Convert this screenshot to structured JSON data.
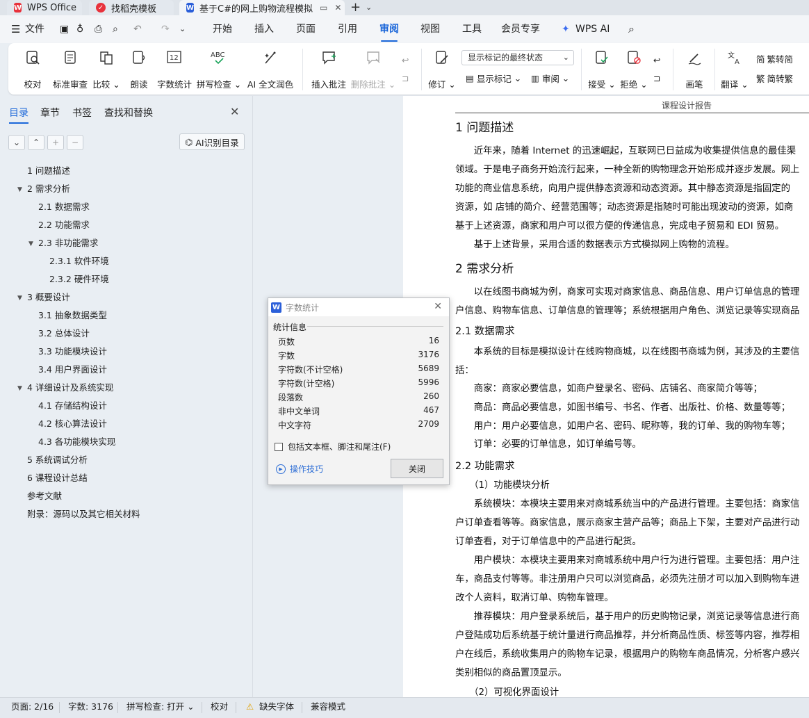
{
  "tabs": [
    {
      "label": "WPS Office"
    },
    {
      "label": "找稻壳模板"
    },
    {
      "label": "基于C#的网上购物流程模拟"
    }
  ],
  "menu": {
    "file": "文件",
    "items": [
      "开始",
      "插入",
      "页面",
      "引用",
      "审阅",
      "视图",
      "工具",
      "会员专享"
    ],
    "active": "审阅",
    "ai": "WPS AI"
  },
  "ribbon": {
    "proofread": "校对",
    "standard_review": "标准审查",
    "compare": "比较",
    "read_aloud": "朗读",
    "word_count": "字数统计",
    "spell_check": "拼写检查",
    "ai_polish": "AI 全文润色",
    "insert_comment": "插入批注",
    "delete_comment": "删除批注",
    "revise": "修订",
    "display_mode": "显示标记的最终状态",
    "show_marks": "显示标记",
    "review": "审阅",
    "accept": "接受",
    "reject": "拒绝",
    "pen": "画笔",
    "translate": "翻译",
    "to_traditional": "繁转简",
    "to_simplified": "简转繁"
  },
  "nav": {
    "tabs": [
      "目录",
      "章节",
      "书签",
      "查找和替换"
    ],
    "ai_toc": "AI识别目录",
    "toc": [
      {
        "label": "1 问题描述"
      },
      {
        "label": "2 需求分析"
      },
      {
        "label": "2.1 数据需求"
      },
      {
        "label": "2.2 功能需求"
      },
      {
        "label": "2.3 非功能需求"
      },
      {
        "label": "2.3.1 软件环境"
      },
      {
        "label": "2.3.2 硬件环境"
      },
      {
        "label": "3 概要设计"
      },
      {
        "label": "3.1 抽象数据类型"
      },
      {
        "label": "3.2 总体设计"
      },
      {
        "label": "3.3 功能模块设计"
      },
      {
        "label": "3.4 用户界面设计"
      },
      {
        "label": "4 详细设计及系统实现"
      },
      {
        "label": "4.1 存储结构设计"
      },
      {
        "label": "4.2 核心算法设计"
      },
      {
        "label": "4.3 各功能模块实现"
      },
      {
        "label": "5 系统调试分析"
      },
      {
        "label": "6 课程设计总结"
      },
      {
        "label": "参考文献"
      },
      {
        "label": "附录：源码以及其它相关材料"
      }
    ]
  },
  "document": {
    "header": "课程设计报告",
    "lines": [
      {
        "text": "1 问题描述",
        "style": "h1"
      },
      {
        "text": "　　近年来，随着 Internet 的迅速崛起，互联网已日益成为收集提供信息的最佳渠",
        "style": "p"
      },
      {
        "text": "领域。于是电子商务开始流行起来，一种全新的购物理念开始形成并逐步发展。网上",
        "style": "p"
      },
      {
        "text": "功能的商业信息系统，向用户提供静态资源和动态资源。其中静态资源是指固定的",
        "style": "p"
      },
      {
        "text": "资源，如 店铺的简介、经营范围等；动态资源是指随时可能出现波动的资源，如商",
        "style": "p"
      },
      {
        "text": "基于上述资源，商家和用户可以很方便的传递信息，完成电子贸易和 EDI 贸易。",
        "style": "p"
      },
      {
        "text": "　　基于上述背景，采用合适的数据表示方式模拟网上购物的流程。",
        "style": "p"
      },
      {
        "text": "2 需求分析",
        "style": "h1"
      },
      {
        "text": "　　以在线图书商城为例，商家可实现对商家信息、商品信息、用户订单信息的管理",
        "style": "p"
      },
      {
        "text": "户信息、购物车信息、订单信息的管理等；系统根据用户角色、浏览记录等实现商品",
        "style": "p"
      },
      {
        "text": "2.1 数据需求",
        "style": "h2"
      },
      {
        "text": "　　本系统的目标是模拟设计在线购物商城，以在线图书商城为例，其涉及的主要信",
        "style": "p"
      },
      {
        "text": "括：",
        "style": "p"
      },
      {
        "text": "　　商家：商家必要信息，如商户登录名、密码、店铺名、商家简介等等；",
        "style": "p"
      },
      {
        "text": "　　商品：商品必要信息，如图书编号、书名、作者、出版社、价格、数量等等；",
        "style": "p"
      },
      {
        "text": "　　用户：用户必要信息，如用户名、密码、昵称等，我的订单、我的购物车等；",
        "style": "p"
      },
      {
        "text": "　　订单：必要的订单信息，如订单编号等。",
        "style": "p"
      },
      {
        "text": "2.2 功能需求",
        "style": "h2"
      },
      {
        "text": "　　（1）功能模块分析",
        "style": "p"
      },
      {
        "text": "　　系统模块：本模块主要用来对商城系统当中的产品进行管理。主要包括：商家信",
        "style": "p"
      },
      {
        "text": "户订单查看等等。商家信息，展示商家主营产品等；商品上下架，主要对产品进行动",
        "style": "p"
      },
      {
        "text": "订单查看，对于订单信息中的产品进行配货。",
        "style": "p"
      },
      {
        "text": "　　用户模块：本模块主要用来对商城系统中用户行为进行管理。主要包括：用户注",
        "style": "p"
      },
      {
        "text": "车，商品支付等等。非注册用户只可以浏览商品，必须先注册才可以加入到购物车进",
        "style": "p"
      },
      {
        "text": "改个人资料，取消订单、购物车管理。",
        "style": "p"
      },
      {
        "text": "　　推荐模块：用户登录系统后，基于用户的历史购物记录，浏览记录等信息进行商",
        "style": "p"
      },
      {
        "text": "户登陆成功后系统基于统计量进行商品推荐，并分析商品性质、标签等内容，推荐相",
        "style": "p"
      },
      {
        "text": "户在线后，系统收集用户的购物车记录，根据用户的购物车商品情况，分析客户感兴",
        "style": "p"
      },
      {
        "text": "类别相似的商品置顶显示。",
        "style": "p"
      },
      {
        "text": "　　（2）可视化界面设计",
        "style": "p"
      }
    ]
  },
  "dialog": {
    "title": "字数统计",
    "section": "统计信息",
    "rows": [
      {
        "label": "页数",
        "value": "16"
      },
      {
        "label": "字数",
        "value": "3176"
      },
      {
        "label": "字符数(不计空格)",
        "value": "5689"
      },
      {
        "label": "字符数(计空格)",
        "value": "5996"
      },
      {
        "label": "段落数",
        "value": "260"
      },
      {
        "label": "非中文单词",
        "value": "467"
      },
      {
        "label": "中文字符",
        "value": "2709"
      }
    ],
    "checkbox_label": "包括文本框、脚注和尾注(F)",
    "tips": "操作技巧",
    "close": "关闭"
  },
  "status": {
    "page": "页面: 2/16",
    "words": "字数: 3176",
    "spell": "拼写检查: 打开",
    "proof": "校对",
    "missing_font": "缺失字体",
    "compat": "兼容模式"
  },
  "colors": {
    "accent": "#1a66d9",
    "wps_red": "#e8323c",
    "word_blue": "#2b5fd9"
  }
}
